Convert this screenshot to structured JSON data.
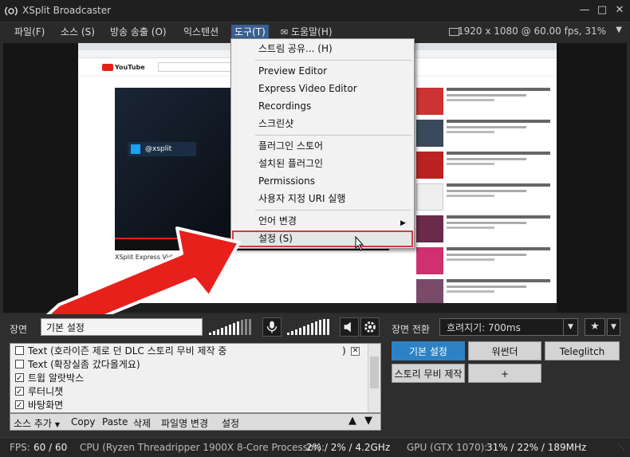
{
  "app": {
    "title": "XSplit Broadcaster"
  },
  "menubar": {
    "items": [
      "파일(F)",
      "소스 (S)",
      "방송 송출 (O)",
      "익스텐션",
      "도구(T)",
      "도움말(H)"
    ],
    "resolution": "1920 x 1080 @ 60.00 fps, 31%"
  },
  "tools_menu": {
    "items": [
      "스트림 공유... (H)",
      "Preview Editor",
      "Express Video Editor",
      "Recordings",
      "스크린샷",
      "플러그인 스토어",
      "설치된 플러그인",
      "Permissions",
      "사용자 지정 URI 실행",
      "언어 변경",
      "설정 (S)"
    ]
  },
  "preview": {
    "logo_text": "YouTube",
    "overlay_handle": "@xsplit",
    "video_title": "XSplit Express Video Editor"
  },
  "scene": {
    "label": "장면",
    "name_value": "기본 설정"
  },
  "sources": {
    "rows": [
      {
        "label": "Text (호라이즌 제로 던 DLC 스토리 무비 제작 중",
        "suffix": ")",
        "checked": false
      },
      {
        "label": "Text (확장실좀 갔다올게요)",
        "checked": false
      },
      {
        "label": "트윕 알랏박스",
        "checked": true
      },
      {
        "label": "루터니챗",
        "checked": true
      },
      {
        "label": "바탕화면",
        "checked": true
      }
    ],
    "toolbar": {
      "add": "소스 추가",
      "copy": "Copy",
      "paste": "Paste",
      "delete": "삭제",
      "rename": "파일명 변경",
      "settings": "설정"
    }
  },
  "transition": {
    "label": "장면 전환",
    "value": "흐려지기: 700ms"
  },
  "scenes": {
    "buttons": [
      "기본 설정",
      "워썬더",
      "Teleglitch",
      "스토리 무비 제작",
      "+"
    ]
  },
  "status": {
    "fps_label": "FPS:",
    "fps_value": "60 / 60",
    "cpu_label": "CPU (Ryzen Threadripper 1900X 8-Core Processor):",
    "cpu_value": "2% / 2% / 4.2GHz",
    "gpu_label": "GPU (GTX 1070):",
    "gpu_value": "31% / 22% / 189MHz"
  },
  "colors": {
    "accent": "#2d82c6",
    "highlight_box": "#d8393a",
    "arrow": "#e8201c",
    "menu_active": "#3a5f8f"
  }
}
